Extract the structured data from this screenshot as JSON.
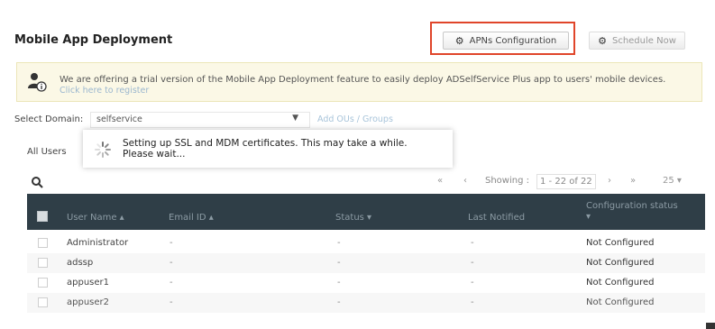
{
  "page": {
    "title": "Mobile App Deployment"
  },
  "toolbar": {
    "apns_label": "APNs Configuration",
    "apns_icon": "gear-icon",
    "schedule_label": "Schedule Now",
    "schedule_icon": "gear-icon",
    "highlight_color": "#e0452a"
  },
  "banner": {
    "line1": "We are offering a trial version of the Mobile App Deployment feature to easily deploy ADSelfService Plus app to users' mobile devices.",
    "line2": "Click here to register",
    "icon": "user-info-icon"
  },
  "domain": {
    "label": "Select Domain:",
    "selected": "selfservice",
    "add_link": "Add OUs / Groups"
  },
  "tabs": {
    "all_users": "All Users"
  },
  "toast": {
    "message": "Setting up SSL and MDM certificates. This may take a while. Please wait..."
  },
  "pager": {
    "first": "«",
    "prev": "‹",
    "showing_label": "Showing :",
    "range": "1 - 22 of 22",
    "next": "›",
    "last": "»",
    "page_size": "25 ▾"
  },
  "table": {
    "headers": {
      "user_name": "User Name ▴",
      "email": "Email ID ▴",
      "status": "Status ▾",
      "last_notified": "Last Notified",
      "config_status": "Configuration status",
      "config_status_arrow": "▾"
    },
    "rows": [
      {
        "user": "Administrator",
        "email": "-",
        "status": "-",
        "notified": "-",
        "config": "Not Configured"
      },
      {
        "user": "adssp",
        "email": "-",
        "status": "-",
        "notified": "-",
        "config": "Not Configured"
      },
      {
        "user": "appuser1",
        "email": "-",
        "status": "-",
        "notified": "-",
        "config": "Not Configured"
      },
      {
        "user": "appuser2",
        "email": "-",
        "status": "-",
        "notified": "-",
        "config": "Not Configured"
      }
    ]
  }
}
